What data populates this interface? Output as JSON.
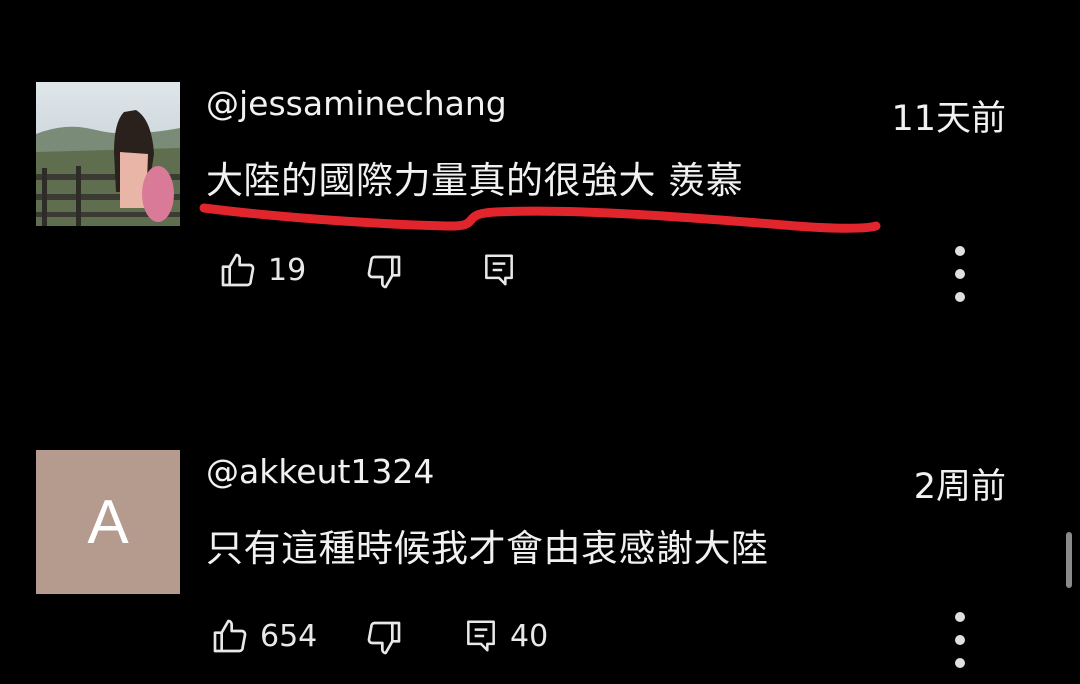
{
  "comments": [
    {
      "username": "@jessaminechang",
      "time": "11天前",
      "text": "大陸的國際力量真的很強大 羨慕",
      "likes": "19",
      "replies": "",
      "avatar_letter": ""
    },
    {
      "username": "@akkeut1324",
      "time": "2周前",
      "text": "只有這種時候我才會由衷感謝大陸",
      "likes": "654",
      "replies": "40",
      "avatar_letter": "A"
    }
  ],
  "colors": {
    "background": "#000000",
    "text": "#f1f1f1",
    "underline": "#e0252c",
    "letter_avatar": "#b59a8e"
  },
  "icons": [
    "thumbs-up-icon",
    "thumbs-down-icon",
    "reply-icon",
    "more-vert-icon"
  ]
}
